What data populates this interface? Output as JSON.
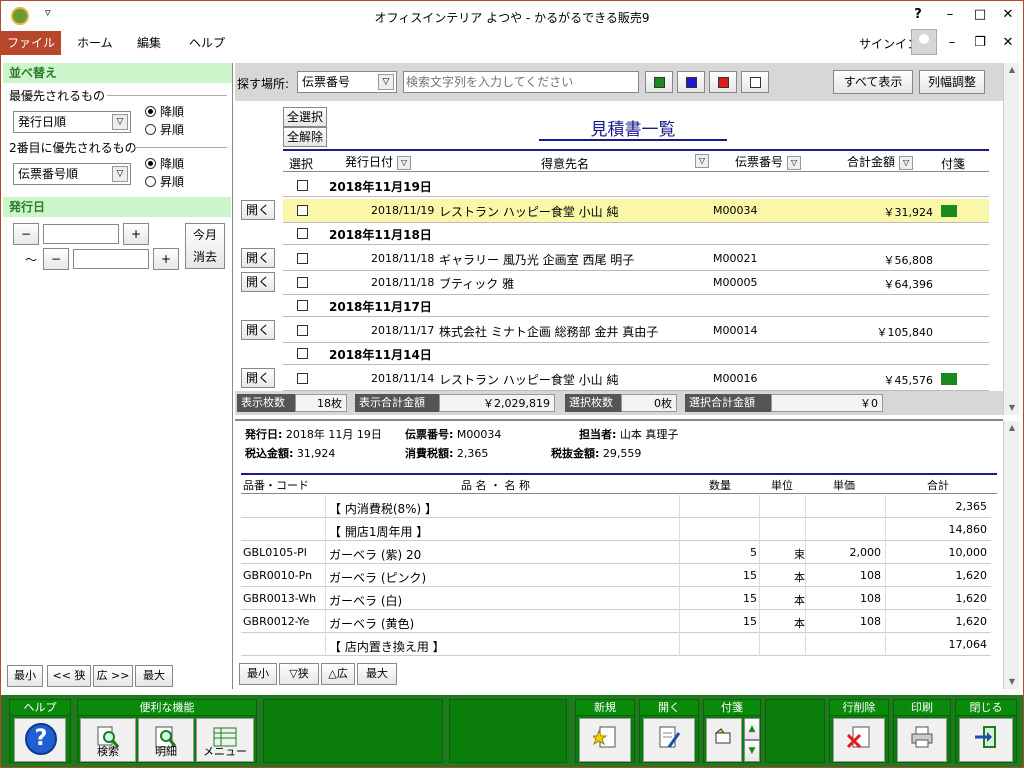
{
  "window": {
    "title": "オフィスインテリア よつや - かるがるできる販売9",
    "qa_glyph": "▿",
    "help": "?",
    "minimize": "–",
    "maximize": "□",
    "close": "✕"
  },
  "ribbon": {
    "tabs": [
      "ファイル",
      "ホーム",
      "編集",
      "ヘルプ"
    ],
    "signin": "サインイン",
    "minimize": "–",
    "restore": "❐",
    "close": "✕"
  },
  "sort": {
    "header": "並べ替え",
    "primary_label": "最優先されるもの",
    "primary_value": "発行日順",
    "primary_desc": "降順",
    "primary_asc": "昇順",
    "secondary_label": "2番目に優先されるもの",
    "secondary_value": "伝票番号順",
    "secondary_desc": "降順",
    "secondary_asc": "昇順"
  },
  "issue_date": {
    "header": "発行日",
    "minus": "−",
    "plus": "+",
    "tilde": "～",
    "this_month": "今月",
    "clear": "消去"
  },
  "left_nav": [
    "最小",
    "<< 狭",
    "広 >>",
    "最大"
  ],
  "search": {
    "label": "探す場所:",
    "field": "伝票番号",
    "placeholder": "検索文字列を入力してください",
    "colors": {
      "green": "#1a8a1a",
      "blue": "#1a1ad6",
      "red": "#e01a1a",
      "white": "#ffffff"
    },
    "show_all": "すべて表示",
    "col_adjust": "列幅調整"
  },
  "list": {
    "select_all": "全選択",
    "deselect_all": "全解除",
    "title": "見積書一覧",
    "headers": {
      "select": "選択",
      "date": "発行日付",
      "customer": "得意先名",
      "slip": "伝票番号",
      "total": "合計金額",
      "tag": "付箋"
    },
    "open_label": "開く",
    "groups": [
      {
        "date": "2018年11月19日",
        "rows": [
          {
            "date": "2018/11/19",
            "customer": "レストラン ハッピー食堂 小山 純",
            "slip": "M00034",
            "total": "￥31,924",
            "tag": "#1a8a1a",
            "highlight": true
          }
        ]
      },
      {
        "date": "2018年11月18日",
        "rows": [
          {
            "date": "2018/11/18",
            "customer": "ギャラリー 風乃光 企画室 西尾 明子",
            "slip": "M00021",
            "total": "￥56,808",
            "tag": "",
            "highlight": false
          },
          {
            "date": "2018/11/18",
            "customer": "ブティック 雅",
            "slip": "M00005",
            "total": "￥64,396",
            "tag": "",
            "highlight": false
          }
        ]
      },
      {
        "date": "2018年11月17日",
        "rows": [
          {
            "date": "2018/11/17",
            "customer": "株式会社 ミナト企画 総務部 金井 真由子",
            "slip": "M00014",
            "total": "￥105,840",
            "tag": "",
            "highlight": false
          }
        ]
      },
      {
        "date": "2018年11月14日",
        "rows": [
          {
            "date": "2018/11/14",
            "customer": "レストラン ハッピー食堂 小山 純",
            "slip": "M00016",
            "total": "￥45,576",
            "tag": "#1a8a1a",
            "highlight": false
          }
        ]
      }
    ]
  },
  "status": {
    "count_label": "表示枚数",
    "count_value": "18枚",
    "sum_label": "表示合計金額",
    "sum_value": "￥2,029,819",
    "sel_label": "選択枚数",
    "sel_value": "0枚",
    "sel_sum_label": "選択合計金額",
    "sel_sum_value": "￥0"
  },
  "detail": {
    "issue_label": "発行日:",
    "issue_value": "2018年 11月 19日",
    "slip_label": "伝票番号:",
    "slip_value": "M00034",
    "staff_label": "担当者:",
    "staff_value": "山本 真理子",
    "taxin_label": "税込金額:",
    "taxin_value": "31,924",
    "tax_label": "消費税額:",
    "tax_value": "2,365",
    "taxex_label": "税抜金額:",
    "taxex_value": "29,559",
    "headers": {
      "code": "品番・コード",
      "name": "品 名 ・ 名 称",
      "qty": "数量",
      "unit": "単位",
      "price": "単価",
      "total": "合計"
    },
    "rows": [
      {
        "code": "",
        "name": "【 内消費税(8%) 】",
        "qty": "",
        "unit": "",
        "price": "",
        "total": "2,365"
      },
      {
        "code": "",
        "name": "【 開店1周年用 】",
        "qty": "",
        "unit": "",
        "price": "",
        "total": "14,860"
      },
      {
        "code": "GBL0105-Pl",
        "name": "ガーベラ (紫) 20",
        "qty": "5",
        "unit": "束",
        "price": "2,000",
        "total": "10,000"
      },
      {
        "code": "GBR0010-Pn",
        "name": "ガーベラ (ピンク)",
        "qty": "15",
        "unit": "本",
        "price": "108",
        "total": "1,620"
      },
      {
        "code": "GBR0013-Wh",
        "name": "ガーベラ (白)",
        "qty": "15",
        "unit": "本",
        "price": "108",
        "total": "1,620"
      },
      {
        "code": "GBR0012-Ye",
        "name": "ガーベラ (黄色)",
        "qty": "15",
        "unit": "本",
        "price": "108",
        "total": "1,620"
      },
      {
        "code": "",
        "name": "【 店内置き換え用 】",
        "qty": "",
        "unit": "",
        "price": "",
        "total": "17,064"
      }
    ]
  },
  "detail_nav": [
    "最小",
    "▽狭",
    "△広",
    "最大"
  ],
  "toolbar": {
    "help_title": "ヘルプ",
    "help_glyph": "?",
    "tools_title": "便利な機能",
    "search": "検索",
    "detail": "明細",
    "menu": "メニュー",
    "new_title": "新規",
    "open_title": "開く",
    "tag_title": "付箋",
    "delete_title": "行削除",
    "print_title": "印刷",
    "close_title": "閉じる"
  }
}
